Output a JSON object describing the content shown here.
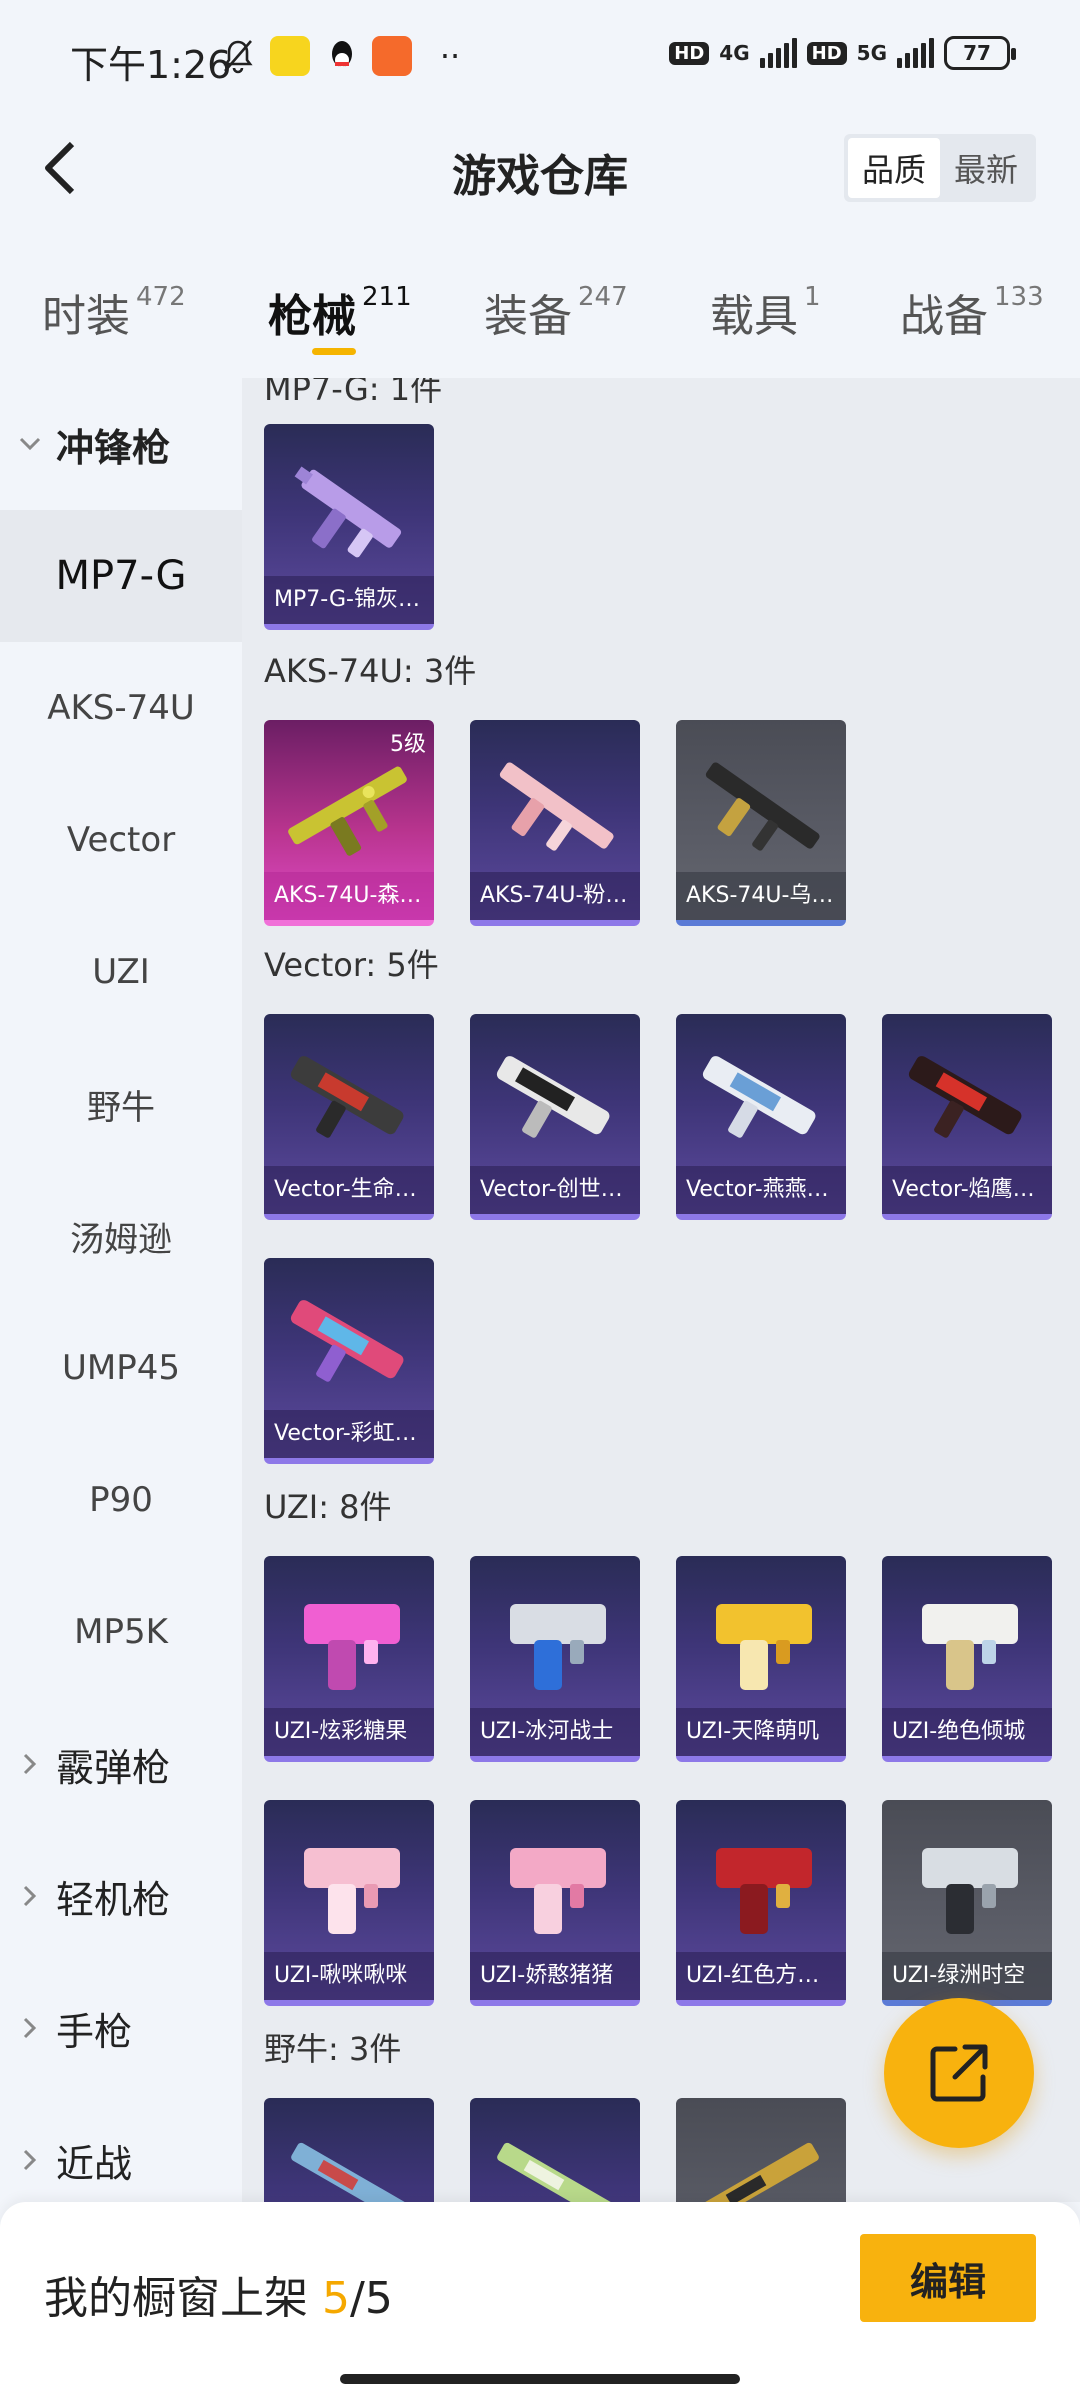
{
  "status_bar": {
    "time": "下午1:26",
    "hd1": "HD",
    "net1": "4G",
    "hd2": "HD",
    "net2": "5G",
    "battery": "77",
    "more": "··"
  },
  "header": {
    "title": "游戏仓库",
    "sort_options": [
      "品质",
      "最新"
    ],
    "sort_selected": "品质"
  },
  "tabs": [
    {
      "label": "时装",
      "count": "472"
    },
    {
      "label": "枪械",
      "count": "211"
    },
    {
      "label": "装备",
      "count": "247"
    },
    {
      "label": "载具",
      "count": "1"
    },
    {
      "label": "战备",
      "count": "133"
    }
  ],
  "active_tab": "枪械",
  "sidebar": {
    "open_group": "冲锋枪",
    "items": [
      "MP7-G",
      "AKS-74U",
      "Vector",
      "UZI",
      "野牛",
      "汤姆逊",
      "UMP45",
      "P90",
      "MP5K"
    ],
    "active_item": "MP7-G",
    "groups": [
      "霰弹枪",
      "轻机枪",
      "手枪",
      "近战"
    ]
  },
  "sections": [
    {
      "title": "MP7-G: 1件",
      "items": [
        {
          "name": "MP7-G-锦灰…",
          "style": "purple"
        }
      ]
    },
    {
      "title": "AKS-74U: 3件",
      "items": [
        {
          "name": "AKS-74U-森…",
          "style": "pink",
          "level": "5级"
        },
        {
          "name": "AKS-74U-粉…",
          "style": "purple"
        },
        {
          "name": "AKS-74U-乌…",
          "style": "gray"
        }
      ]
    },
    {
      "title": "Vector: 5件",
      "items": [
        {
          "name": "Vector-生命…",
          "style": "purple"
        },
        {
          "name": "Vector-创世…",
          "style": "purple"
        },
        {
          "name": "Vector-燕燕…",
          "style": "purple"
        },
        {
          "name": "Vector-焰鹰…",
          "style": "purple"
        },
        {
          "name": "Vector-彩虹…",
          "style": "purple"
        }
      ]
    },
    {
      "title": "UZI: 8件",
      "items": [
        {
          "name": "UZI-炫彩糖果",
          "style": "purple"
        },
        {
          "name": "UZI-冰河战士",
          "style": "purple"
        },
        {
          "name": "UZI-天降萌叽",
          "style": "purple"
        },
        {
          "name": "UZI-绝色倾城",
          "style": "purple"
        },
        {
          "name": "UZI-啾咪啾咪",
          "style": "purple"
        },
        {
          "name": "UZI-娇憨猪猪",
          "style": "purple"
        },
        {
          "name": "UZI-红色方…",
          "style": "purple"
        },
        {
          "name": "UZI-绿洲时空",
          "style": "gray"
        }
      ]
    },
    {
      "title": "野牛: 3件",
      "items": [
        {
          "name": "",
          "style": "purple"
        },
        {
          "name": "",
          "style": "purple"
        },
        {
          "name": "",
          "style": "gray"
        }
      ]
    }
  ],
  "bottom": {
    "shelf_label": "我的橱窗上架",
    "shelf_current": "5",
    "shelf_sep": "/",
    "shelf_total": "5",
    "edit_label": "编辑"
  },
  "colors": {
    "accent": "#f8b20e",
    "card_purple": "#3e3578",
    "card_pink": "#d13fb0",
    "card_gray": "#5a5c66"
  }
}
